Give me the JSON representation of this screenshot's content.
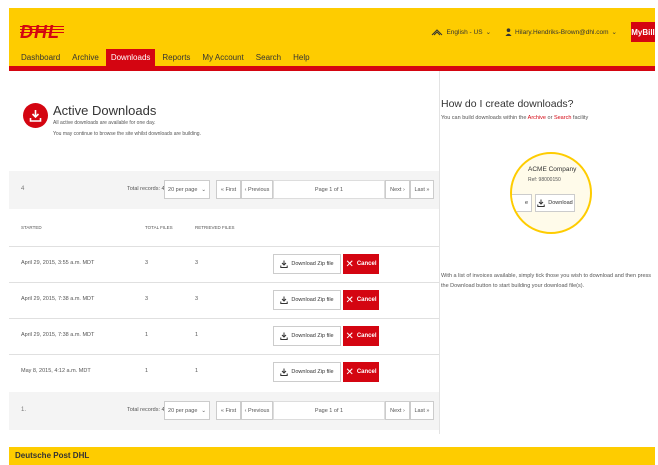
{
  "brand": {
    "logo": "DHL",
    "accent": "#d40511",
    "yellow": "#fecc00"
  },
  "header": {
    "language": "English - US",
    "user_email": "Hilary.Hendriks-Brown@dhl.com",
    "mybill": "MyBill"
  },
  "nav": {
    "items": [
      {
        "label": "Dashboard",
        "active": false
      },
      {
        "label": "Archive",
        "active": false
      },
      {
        "label": "Downloads",
        "active": true
      },
      {
        "label": "Reports",
        "active": false
      },
      {
        "label": "My Account",
        "active": false
      },
      {
        "label": "Search",
        "active": false
      },
      {
        "label": "Help",
        "active": false
      }
    ]
  },
  "page": {
    "title": "Active Downloads",
    "subtitle1": "All active downloads are available for one day.",
    "subtitle2": "You may continue to browse the site whilst downloads are building."
  },
  "pager_top": {
    "count": "4",
    "total": "Total records: 4",
    "per_page": "20 per page",
    "first": "« First",
    "previous": "‹ Previous",
    "page": "Page 1 of 1",
    "next": "Next ›",
    "last": "Last »"
  },
  "pager_bottom": {
    "count": "1.",
    "total": "Total records: 4",
    "per_page": "20 per page",
    "first": "« First",
    "previous": "‹ Previous",
    "page": "Page 1 of 1",
    "next": "Next ›",
    "last": "Last »"
  },
  "table": {
    "headers": {
      "started": "STARTED",
      "total": "TOTAL FILES",
      "retrieved": "RETRIEVED FILES"
    },
    "zip_label": "Download Zip file",
    "cancel_label": "Cancel",
    "rows": [
      {
        "started": "April 29, 2015, 3:55 a.m. MDT",
        "total": "3",
        "retrieved": "3"
      },
      {
        "started": "April 29, 2015, 7:38 a.m. MDT",
        "total": "3",
        "retrieved": "3"
      },
      {
        "started": "April 29, 2015, 7:38 a.m. MDT",
        "total": "1",
        "retrieved": "1"
      },
      {
        "started": "May 8, 2015, 4:12 a.m. MDT",
        "total": "1",
        "retrieved": "1"
      }
    ]
  },
  "side": {
    "title": "How do I create downloads?",
    "sub_pre": "You can build downloads within the",
    "sub_link1": "Archive",
    "sub_or": "or",
    "sub_link2": "Search",
    "sub_post": "facility",
    "demo_company": "ACME Company",
    "demo_ref": "Ref: 98000150",
    "demo_left": "e",
    "demo_button": "Download",
    "description": "With a list of invoices available, simply tick those you wish to download and then press the Download button to start building your download file(s)."
  },
  "footer": {
    "text": "Deutsche Post DHL"
  }
}
